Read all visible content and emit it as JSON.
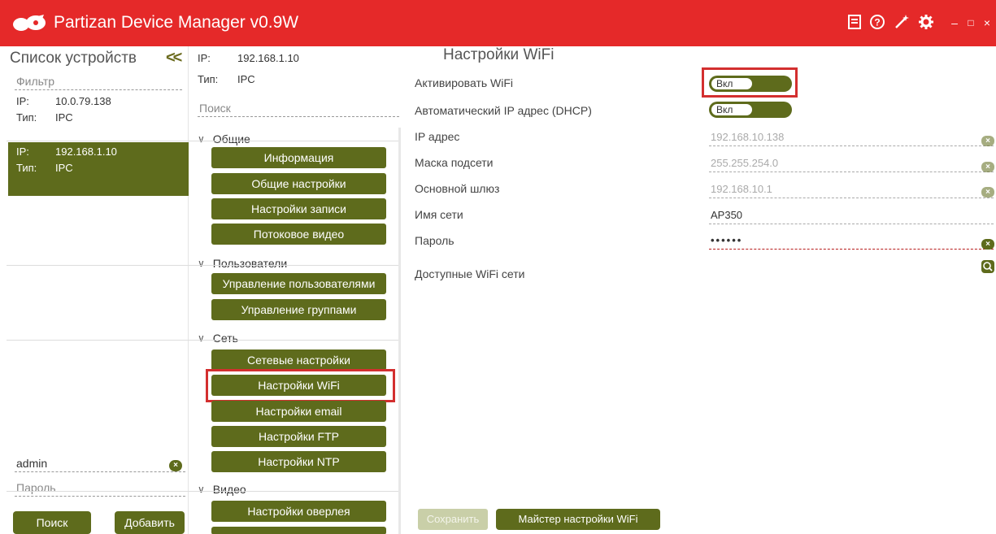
{
  "window": {
    "title": "Partizan Device Manager v0.9W",
    "icons": [
      "book-icon",
      "help-icon",
      "wand-icon",
      "gear-icon",
      "minimize-icon",
      "maximize-icon",
      "close-icon"
    ]
  },
  "devices_panel": {
    "title": "Список устройств",
    "collapse_label": "<<",
    "filter_placeholder": "Фильтр",
    "items": [
      {
        "ip_key": "IP:",
        "ip": "10.0.79.138",
        "type_key": "Тип:",
        "type": "IPC",
        "selected": false
      },
      {
        "ip_key": "IP:",
        "ip": "192.168.1.10",
        "type_key": "Тип:",
        "type": "IPC",
        "selected": true
      }
    ],
    "login_value": "admin",
    "password_placeholder": "Пароль",
    "search_button": "Поиск",
    "add_button": "Добавить"
  },
  "device_menu": {
    "ip_key": "IP:",
    "ip": "192.168.1.10",
    "type_key": "Тип:",
    "type": "IPC",
    "search_placeholder": "Поиск",
    "sections": [
      {
        "title": "Общие",
        "items": [
          "Информация",
          "Общие настройки",
          "Настройки записи",
          "Потоковое видео"
        ]
      },
      {
        "title": "Пользователи",
        "items": [
          "Управление пользователями",
          "Управление группами"
        ]
      },
      {
        "title": "Сеть",
        "items": [
          "Сетевые настройки",
          "Настройки WiFi",
          "Настройки email",
          "Настройки FTP",
          "Настройки NTP"
        ]
      },
      {
        "title": "Видео",
        "items": [
          "Настройки оверлея"
        ]
      }
    ],
    "active_item": "Настройки WiFi"
  },
  "wifi_settings": {
    "title": "Настройки WiFi",
    "enable_label": "Активировать WiFi",
    "enable_value": "Вкл",
    "dhcp_label": "Автоматический IP адрес (DHCP)",
    "dhcp_value": "Вкл",
    "ip_label": "IP адрес",
    "ip_value": "192.168.10.138",
    "mask_label": "Маска подсети",
    "mask_value": "255.255.254.0",
    "gateway_label": "Основной шлюз",
    "gateway_value": "192.168.10.1",
    "ssid_label": "Имя сети",
    "ssid_value": "AP350",
    "password_label": "Пароль",
    "password_value": "••••••",
    "available_label": "Доступные WiFi сети",
    "save_button": "Сохранить",
    "wizard_button": "Майстер настройки WiFi"
  },
  "colors": {
    "titlebar": "#e52929",
    "accent": "#5e6b1c",
    "highlight": "#d32f2f"
  }
}
